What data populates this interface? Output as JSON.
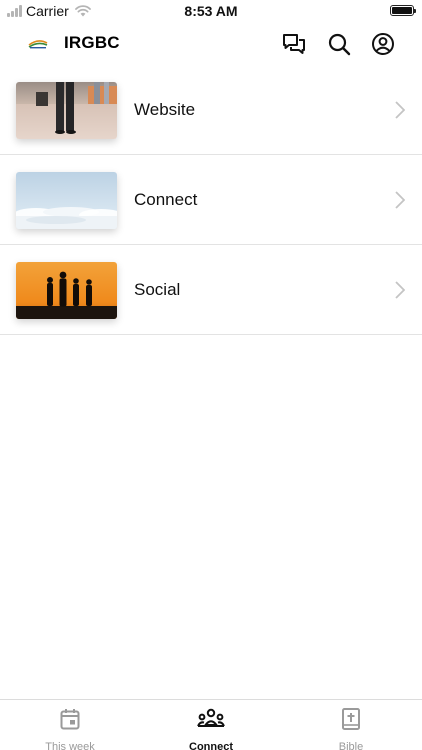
{
  "status_bar": {
    "carrier": "Carrier",
    "time": "8:53 AM"
  },
  "header": {
    "title": "IRGBC"
  },
  "icons": {
    "chat": "chat-bubbles-icon",
    "search": "search-icon",
    "account": "account-circle-icon",
    "chevron": "chevron-right-icon",
    "this_week": "calendar-icon",
    "connect": "people-group-icon",
    "bible": "bible-icon"
  },
  "list": {
    "items": [
      {
        "label": "Website"
      },
      {
        "label": "Connect"
      },
      {
        "label": "Social"
      }
    ]
  },
  "tabs": [
    {
      "label": "This week",
      "active": false
    },
    {
      "label": "Connect",
      "active": true
    },
    {
      "label": "Bible",
      "active": false
    }
  ],
  "colors": {
    "active_tab": "#111111",
    "inactive_tab": "#9a9a9a",
    "divider": "#e3e3e3",
    "logo_green": "#3a8a3a",
    "logo_orange": "#e08a1e"
  }
}
